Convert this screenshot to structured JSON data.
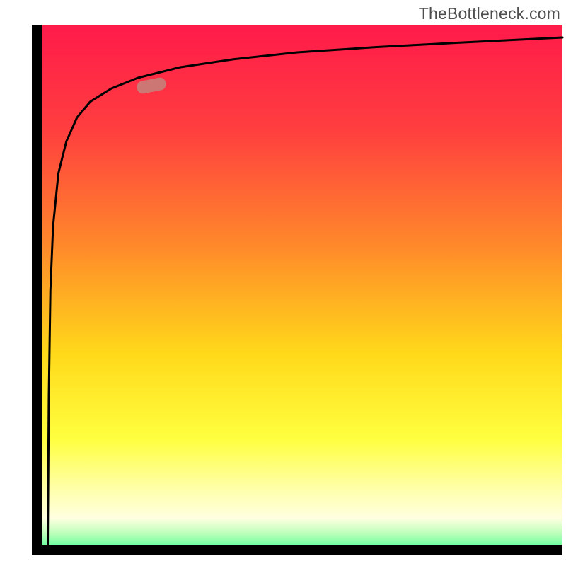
{
  "attribution": "TheBottleneck.com",
  "gradient": {
    "stops": [
      {
        "offset": 0.0,
        "color": "#ff1a4a"
      },
      {
        "offset": 0.2,
        "color": "#ff3f3f"
      },
      {
        "offset": 0.42,
        "color": "#ff8a2a"
      },
      {
        "offset": 0.62,
        "color": "#ffd91a"
      },
      {
        "offset": 0.78,
        "color": "#ffff3f"
      },
      {
        "offset": 0.88,
        "color": "#ffffb0"
      },
      {
        "offset": 0.93,
        "color": "#ffffe0"
      },
      {
        "offset": 0.96,
        "color": "#b8ffb8"
      },
      {
        "offset": 1.0,
        "color": "#2eff8f"
      }
    ]
  },
  "marker": {
    "x_pct": 22.5,
    "y_pct": 11.5,
    "rotation_deg": -11
  },
  "chart_data": {
    "type": "line",
    "title": "",
    "xlabel": "",
    "ylabel": "",
    "xlim": [
      0,
      100
    ],
    "ylim": [
      0,
      100
    ],
    "series": [
      {
        "name": "curve",
        "x": [
          3.0,
          3.2,
          3.5,
          4.0,
          5.0,
          6.5,
          8.5,
          11.0,
          15.0,
          20.0,
          28.0,
          38.0,
          50.0,
          65.0,
          80.0,
          92.0,
          100.0
        ],
        "values": [
          2.0,
          30.0,
          50.0,
          62.0,
          72.0,
          78.0,
          82.5,
          85.5,
          88.0,
          90.0,
          92.0,
          93.5,
          94.8,
          95.8,
          96.6,
          97.2,
          97.6
        ]
      }
    ],
    "annotations": [
      {
        "kind": "marker",
        "x": 22.5,
        "y": 88.5
      }
    ]
  }
}
